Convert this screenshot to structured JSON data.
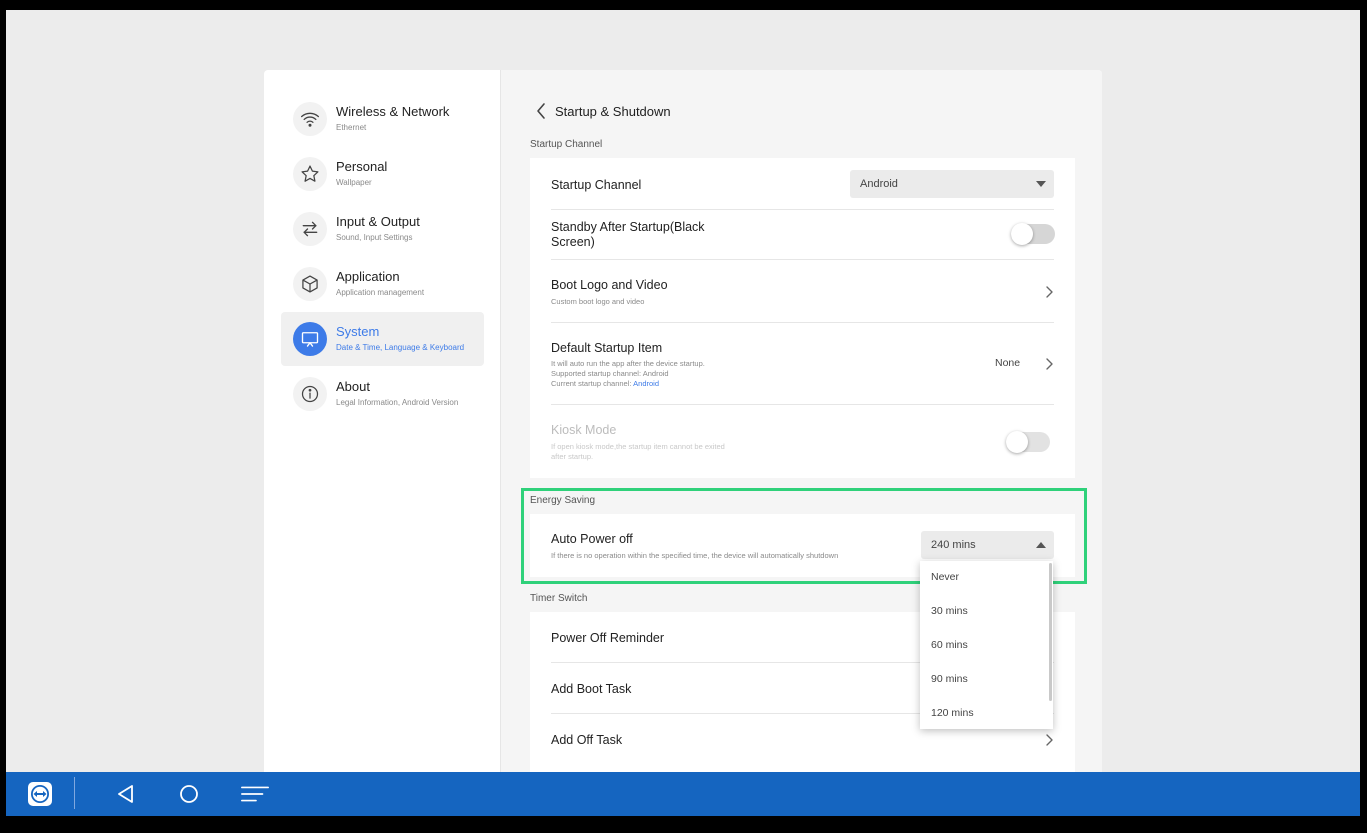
{
  "sidebar": {
    "items": [
      {
        "title": "Wireless & Network",
        "subtitle": "Ethernet",
        "icon": "wifi-icon"
      },
      {
        "title": "Personal",
        "subtitle": "Wallpaper",
        "icon": "star-icon"
      },
      {
        "title": "Input & Output",
        "subtitle": "Sound, Input Settings",
        "icon": "swap-arrows-icon"
      },
      {
        "title": "Application",
        "subtitle": "Application management",
        "icon": "cube-icon"
      },
      {
        "title": "System",
        "subtitle": "Date & Time, Language & Keyboard",
        "icon": "monitor-icon",
        "active": true
      },
      {
        "title": "About",
        "subtitle": "Legal Information, Android Version",
        "icon": "info-icon"
      }
    ]
  },
  "header": {
    "title": "Startup & Shutdown"
  },
  "startup": {
    "section_label": "Startup Channel",
    "channel": {
      "title": "Startup Channel",
      "value": "Android"
    },
    "standby": {
      "title_line1": "Standby After Startup(Black",
      "title_line2": "Screen)",
      "enabled": false
    },
    "boot_logo": {
      "title": "Boot Logo and Video",
      "subtitle": "Custom boot logo and video"
    },
    "default_item": {
      "title": "Default Startup Item",
      "line1": "It will auto run the app after the device startup.",
      "line2": "Supported startup channel: Android",
      "line3_prefix": "Current startup channel: ",
      "line3_link": "Android",
      "value": "None"
    },
    "kiosk": {
      "title": "Kiosk Mode",
      "line1": "If open kiosk mode,the startup item cannot be exited",
      "line2": "after startup.",
      "enabled": false,
      "disabled": true
    }
  },
  "energy": {
    "section_label": "Energy Saving",
    "auto_power_off": {
      "title": "Auto Power off",
      "subtitle": "If there is no operation within the specified time, the device will automatically shutdown",
      "value": "240 mins"
    },
    "dropdown_options": [
      "Never",
      "30 mins",
      "60 mins",
      "90 mins",
      "120 mins"
    ]
  },
  "timer": {
    "section_label": "Timer Switch",
    "items": [
      "Power Off Reminder",
      "Add Boot Task",
      "Add Off Task"
    ]
  },
  "colors": {
    "accent": "#3d7be8",
    "taskbar": "#1565c0",
    "highlight": "#2fd17a"
  }
}
